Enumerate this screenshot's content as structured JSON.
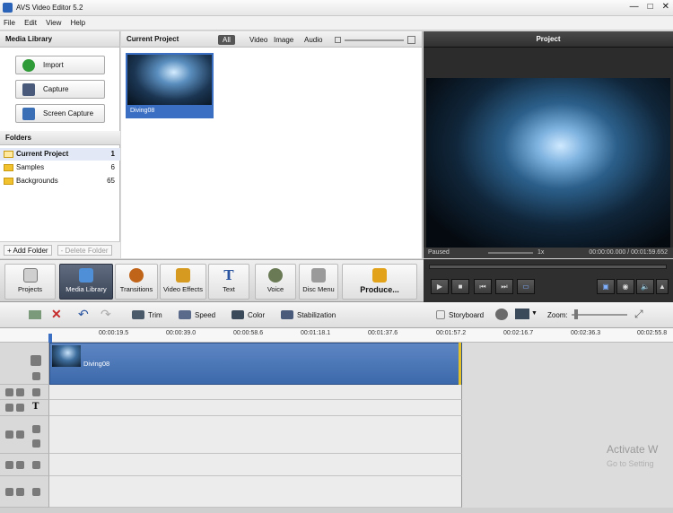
{
  "window": {
    "title": "AVS Video Editor 5.2",
    "controls": [
      "minimize-icon",
      "maximize-icon",
      "close-icon"
    ]
  },
  "menu": [
    "File",
    "Edit",
    "View",
    "Help"
  ],
  "media_library": {
    "title": "Media Library",
    "buttons": [
      "Import",
      "Capture",
      "Screen Capture"
    ],
    "folders_title": "Folders",
    "folders": [
      {
        "name": "Current Project",
        "count": "1"
      },
      {
        "name": "Samples",
        "count": "6"
      },
      {
        "name": "Backgrounds",
        "count": "65"
      }
    ],
    "add_folder": "+ Add Folder",
    "delete_folder": "- Delete Folder"
  },
  "current_project": {
    "title": "Current Project",
    "filters": [
      "All",
      "Video",
      "Image",
      "Audio"
    ],
    "active_filter": "All",
    "item_label": "Diving08"
  },
  "preview": {
    "title": "Project",
    "status": "Paused",
    "speed": "1x",
    "time": "00:00:00.000 / 00:01:59.652"
  },
  "toolbar": [
    "Projects",
    "Media Library",
    "Transitions",
    "Video Effects",
    "Text",
    "Voice",
    "Disc Menu",
    "Produce..."
  ],
  "timeline_tools": {
    "trim": "Trim",
    "speed": "Speed",
    "color": "Color",
    "stabilization": "Stabilization",
    "storyboard": "Storyboard",
    "zoom": "Zoom:"
  },
  "ruler": [
    "00:00:19.5",
    "00:00:39.0",
    "00:00:58.6",
    "00:01:18.1",
    "00:01:37.6",
    "00:01:57.2",
    "00:02:16.7",
    "00:02:36.3",
    "00:02:55.8"
  ],
  "clip": {
    "name": "Diving08"
  },
  "watermark": {
    "line1": "Activate W",
    "line2": "Go to Setting"
  },
  "colors": {
    "accent": "#3a6fc4",
    "clip": "#4a76b8",
    "marker": "#e6c229"
  }
}
